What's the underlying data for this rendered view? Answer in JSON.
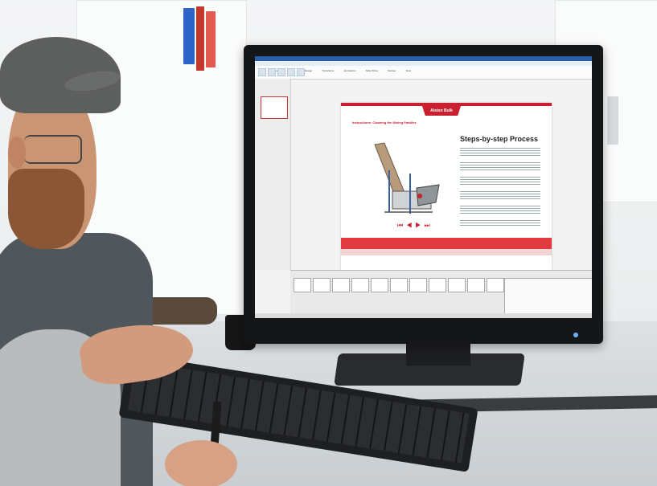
{
  "photo": {
    "subject": "person at desk using software on monitor"
  },
  "app": {
    "logo_text": "Alston Bulk",
    "ribbon_tabs": [
      "File",
      "Home",
      "Insert",
      "Design",
      "Transitions",
      "Animations",
      "Slide Show",
      "Review",
      "View"
    ],
    "document": {
      "title": "Instructions: Cleaning the Mixing Paddles",
      "steps_heading": "Steps-by-step Process"
    }
  },
  "colors": {
    "brand_red": "#c9202f",
    "accent_blue": "#2b5ea6"
  }
}
